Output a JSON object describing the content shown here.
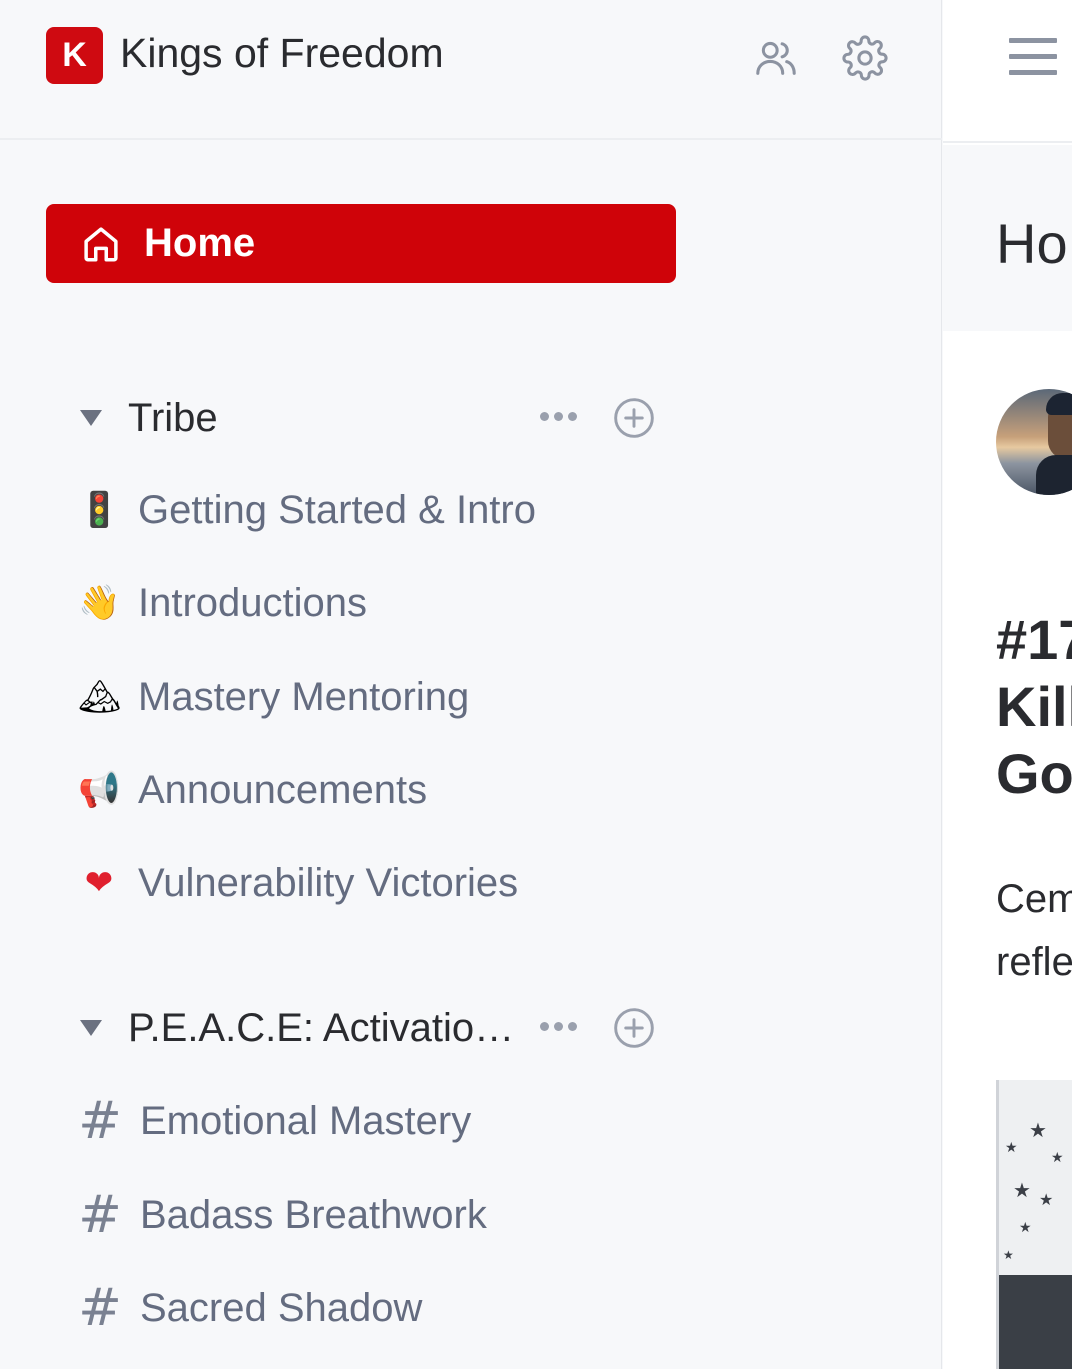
{
  "community": {
    "logo_letter": "K",
    "name": "Kings of Freedom",
    "brand_color": "#cf0a11"
  },
  "header_icons": {
    "members": "members-icon",
    "settings": "gear-icon",
    "menu": "menu-icon"
  },
  "nav": {
    "home_label": "Home"
  },
  "groups": [
    {
      "title": "Tribe",
      "items": [
        {
          "icon": "🚦",
          "label": "Getting Started & Intro"
        },
        {
          "icon": "👋",
          "label": "Introductions"
        },
        {
          "icon": "🏔",
          "label": "Mastery Mentoring"
        },
        {
          "icon": "📢",
          "label": "Announcements"
        },
        {
          "icon": "❤",
          "label": "Vulnerability Victories"
        }
      ]
    },
    {
      "title": "P.E.A.C.E: Activatio…",
      "items": [
        {
          "icon": "#",
          "label": "Emotional Mastery"
        },
        {
          "icon": "#",
          "label": "Badass Breathwork"
        },
        {
          "icon": "#",
          "label": "Sacred Shadow"
        }
      ]
    }
  ],
  "main": {
    "title": "Ho",
    "post_title_lines": [
      "#17",
      "Kill",
      "Goi"
    ],
    "post_excerpt_lines": [
      "Cem",
      "refle"
    ]
  }
}
